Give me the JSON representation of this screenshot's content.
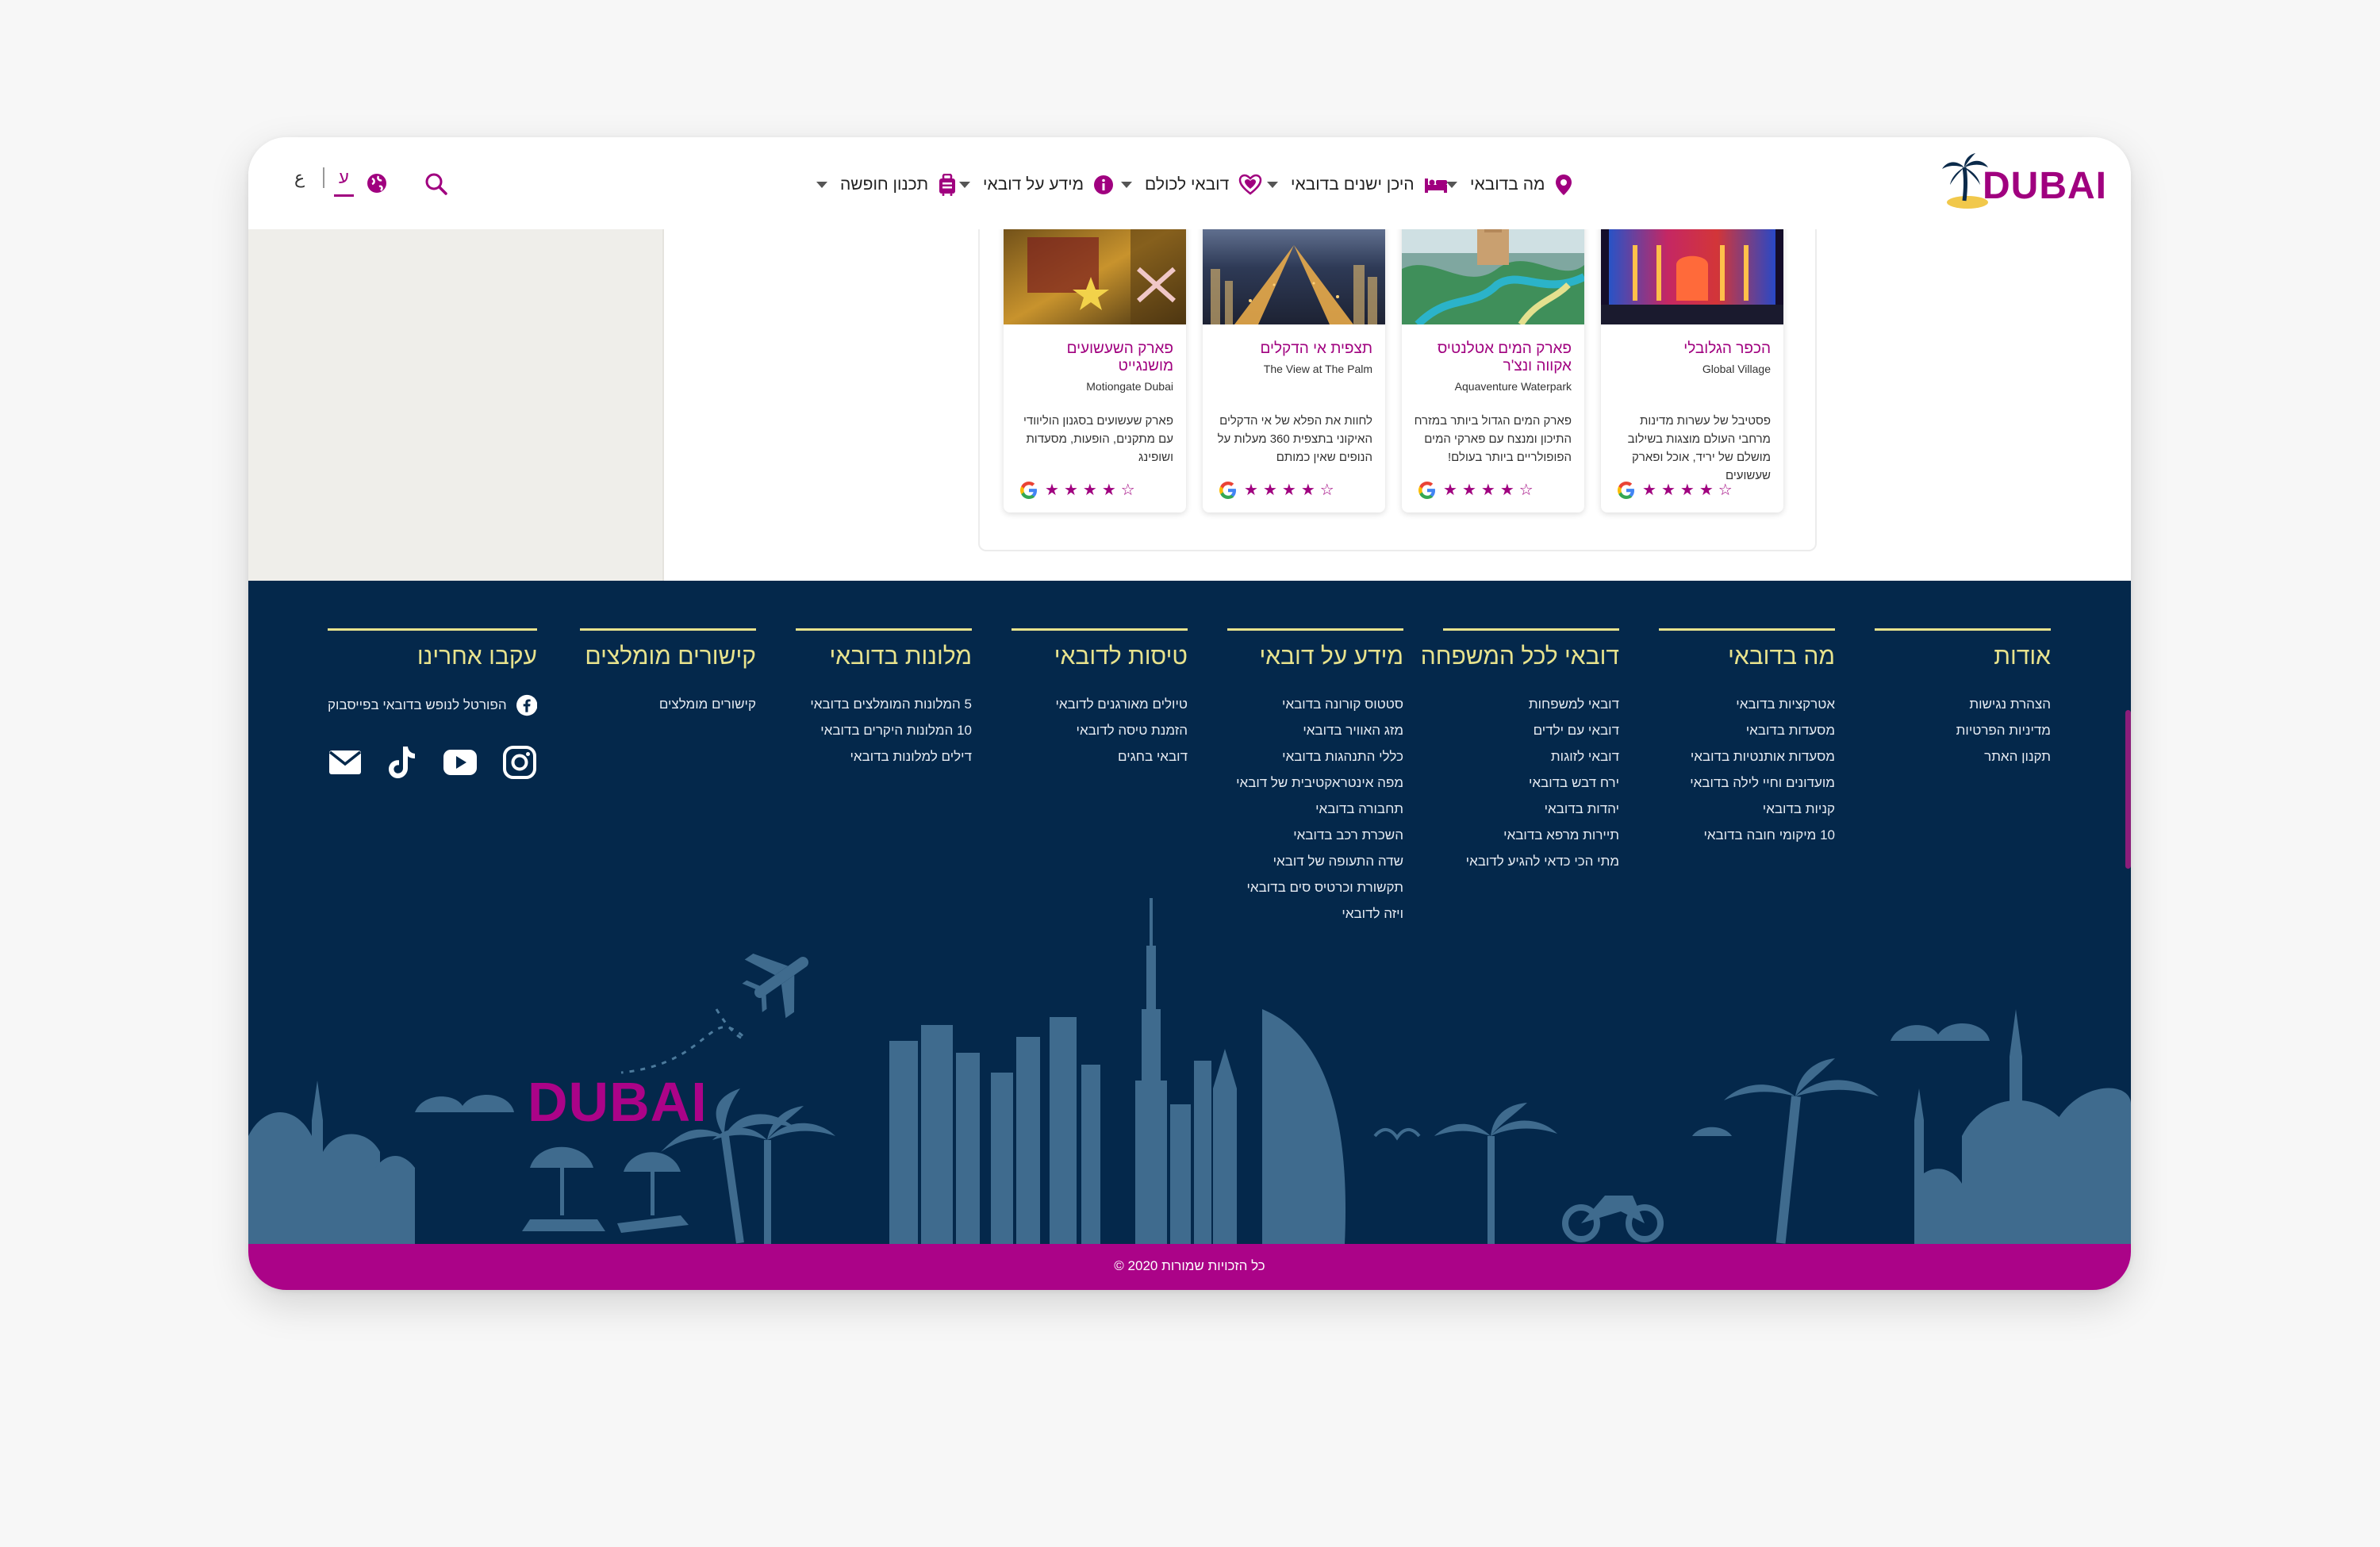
{
  "header": {
    "logo_text": "DUBAI",
    "nav": [
      {
        "label": "מה בדובאי",
        "icon": "map-pin-icon",
        "has_dropdown": true
      },
      {
        "label": "היכן ישנים בדובאי",
        "icon": "bed-icon",
        "has_dropdown": true
      },
      {
        "label": "דובאי לכולם",
        "icon": "heart-hands-icon",
        "has_dropdown": true
      },
      {
        "label": "מידע על דובאי",
        "icon": "info-icon",
        "has_dropdown": true
      },
      {
        "label": "תכנון חופשה",
        "icon": "suitcase-icon",
        "has_dropdown": true
      }
    ],
    "lang_active": "ע",
    "lang_other": "ع",
    "accent_color": "#a0007f"
  },
  "cards": [
    {
      "title": "הכפר הגלובלי",
      "subtitle": "Global Village",
      "description": "פסטיבל של עשרות מדינות מרחבי העולם מוצגות בשילוב מושלם של יריד, אוכל ופארק שעשועים",
      "rating_icon": "google-icon",
      "stars": 5
    },
    {
      "title": "פארק המים אטלנטיס אקווה ונצ'ר",
      "subtitle": "Aquaventure Waterpark",
      "description": "פארק המים הגדול ביותר במזרח התיכון ומנצח עם פארקי המים הפופולריים ביותר בעולם!",
      "rating_icon": "google-icon",
      "stars": 5
    },
    {
      "title": "תצפית אי הדקלים",
      "subtitle": "The View at The Palm",
      "description": "לחוות את הפלא של אי הדקלים האיקוני בתצפית 360 מעלות על הנופים שאין כמותם",
      "rating_icon": "google-icon",
      "stars": 5
    },
    {
      "title": "פארק השעשועים מושנגייט",
      "subtitle": "Motiongate Dubai",
      "description": "פארק שעשועים בסגנון הוליוודי עם מתקנים, הופעות, מסעדות ושופינג",
      "rating_icon": "google-icon",
      "stars": 5
    }
  ],
  "footer": {
    "columns": [
      {
        "title": "אודות",
        "links": [
          "הצהרת נגישות",
          "מדיניות הפרטיות",
          "תקנון האתר"
        ]
      },
      {
        "title": "מה בדובאי",
        "links": [
          "אטרקציות בדובאי",
          "מסעדות בדובאי",
          "מסעדות אותנטיות בדובאי",
          "מועדונים וחיי לילה בדובאי",
          "קניות בדובאי",
          "10 מיקומי חובה בדובאי"
        ]
      },
      {
        "title": "דובאי לכל המשפחה",
        "links": [
          "דובאי למשפחות",
          "דובאי עם ילדים",
          "דובאי לזוגות",
          "ירח דבש בדובאי",
          "יהדות בדובאי",
          "תיירות מרפא בדובאי",
          "מתי הכי כדאי להגיע לדובאי"
        ]
      },
      {
        "title": "מידע על דובאי",
        "links": [
          "סטטוס קורונה בדובאי",
          "מזג האוויר בדובאי",
          "כללי התנהגות בדובאי",
          "מפה אינטראקטיבית של דובאי",
          "תחבורה בדובאי",
          "השכרת רכב בדובאי",
          "שדה התעופה של דובאי",
          "תקשורת וכרטיס סים בדובאי",
          "ויזה לדובאי"
        ]
      },
      {
        "title": "טיסות לדובאי",
        "links": [
          "טיולים מאורגנים לדובאי",
          "הזמנת טיסה לדובאי",
          "דובאי בחגים"
        ]
      },
      {
        "title": "מלונות בדובאי",
        "links": [
          "5 המלונות המומלצים בדובאי",
          "10 המלונות היקרים בדובאי",
          "דילים למלונות בדובאי"
        ]
      },
      {
        "title": "קישורים מומלצים",
        "links": [
          "קישורים מומלצים"
        ]
      },
      {
        "title": "עקבו אחרינו",
        "links": [
          "הפורטל לנופש בדובאי בפייסבוק"
        ]
      }
    ],
    "social_icons": [
      "instagram-icon",
      "youtube-icon",
      "tiktok-icon",
      "email-icon"
    ],
    "skyline_logo": "DUBAI",
    "background_color": "#04284b",
    "heading_color": "#e8e38d",
    "copyright": "© כל הזכויות שמורות 2020",
    "copyright_bar_color": "#ab0388"
  }
}
